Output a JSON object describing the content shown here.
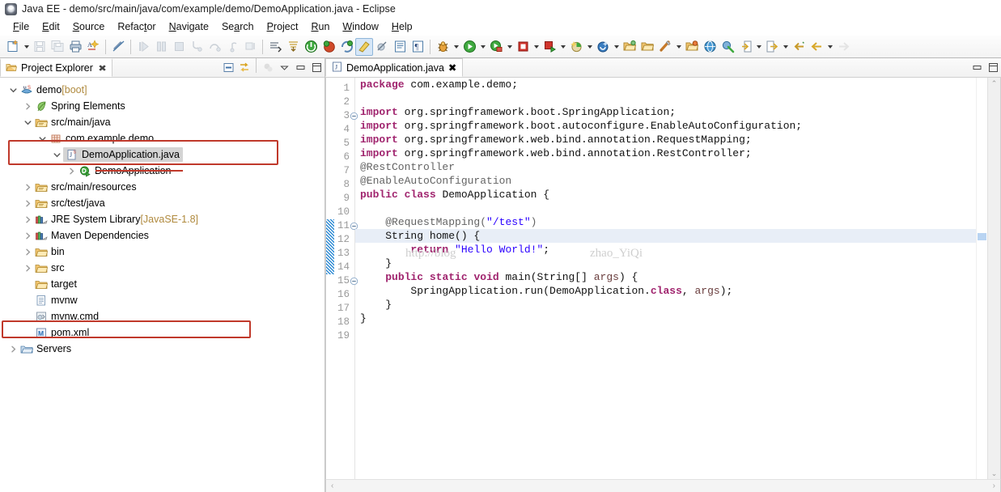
{
  "window": {
    "title": "Java EE - demo/src/main/java/com/example/demo/DemoApplication.java - Eclipse",
    "app_icon": "eclipse-icon"
  },
  "menubar": {
    "items": [
      {
        "label": "File",
        "mnemonic": "F"
      },
      {
        "label": "Edit",
        "mnemonic": "E"
      },
      {
        "label": "Source",
        "mnemonic": "S"
      },
      {
        "label": "Refactor",
        "mnemonic": "t"
      },
      {
        "label": "Navigate",
        "mnemonic": "N"
      },
      {
        "label": "Search",
        "mnemonic": "a"
      },
      {
        "label": "Project",
        "mnemonic": "P"
      },
      {
        "label": "Run",
        "mnemonic": "R"
      },
      {
        "label": "Window",
        "mnemonic": "W"
      },
      {
        "label": "Help",
        "mnemonic": "H"
      }
    ]
  },
  "toolbar": {
    "groups": [
      {
        "items": [
          {
            "name": "new-wizard-icon",
            "enabled": true,
            "dropdown": true
          },
          {
            "name": "save-icon",
            "enabled": false
          },
          {
            "name": "save-all-icon",
            "enabled": false
          },
          {
            "name": "print-icon",
            "enabled": true
          },
          {
            "name": "spell-check-icon",
            "enabled": true
          }
        ]
      },
      {
        "items": [
          {
            "name": "link-break-icon",
            "enabled": true
          }
        ]
      },
      {
        "items": [
          {
            "name": "resume-icon",
            "enabled": false
          },
          {
            "name": "suspend-icon",
            "enabled": false
          },
          {
            "name": "terminate-icon",
            "enabled": false
          },
          {
            "name": "step-into-icon",
            "enabled": false
          },
          {
            "name": "step-over-icon",
            "enabled": false
          },
          {
            "name": "step-return-icon",
            "enabled": false
          },
          {
            "name": "drop-to-frame-icon",
            "enabled": false
          }
        ]
      },
      {
        "items": [
          {
            "name": "next-annotation-icon",
            "enabled": true
          },
          {
            "name": "previous-annotation-icon",
            "enabled": true
          },
          {
            "name": "server-start-icon",
            "enabled": true
          },
          {
            "name": "server-debug-icon",
            "enabled": true
          },
          {
            "name": "server-restart-icon",
            "enabled": true
          },
          {
            "name": "toggle-markoccurrences-icon",
            "enabled": true,
            "active": true
          },
          {
            "name": "skip-breakpoints-icon",
            "enabled": true
          },
          {
            "name": "open-task-icon",
            "enabled": true
          },
          {
            "name": "show-whitespace-icon",
            "enabled": true
          }
        ]
      },
      {
        "items": [
          {
            "name": "debug-icon",
            "enabled": true,
            "dropdown": true
          },
          {
            "name": "run-icon",
            "enabled": true,
            "dropdown": true
          },
          {
            "name": "run-as-server-icon",
            "enabled": true,
            "dropdown": true
          },
          {
            "name": "stop-icon",
            "enabled": true,
            "dropdown": true
          },
          {
            "name": "run-last-icon",
            "enabled": true,
            "dropdown": true
          },
          {
            "name": "coverage-icon",
            "enabled": true,
            "dropdown": true
          },
          {
            "name": "spring-boot-icon",
            "enabled": true,
            "dropdown": true
          },
          {
            "name": "new-java-package-icon",
            "enabled": true
          },
          {
            "name": "new-folder-icon",
            "enabled": true
          },
          {
            "name": "new-class-icon",
            "enabled": true,
            "dropdown": true
          },
          {
            "name": "open-type-icon",
            "enabled": true
          },
          {
            "name": "open-web-browser-icon",
            "enabled": true
          },
          {
            "name": "external-tools-icon",
            "enabled": true
          },
          {
            "name": "import-icon",
            "enabled": true,
            "dropdown": true
          },
          {
            "name": "export-icon",
            "enabled": true,
            "dropdown": true
          },
          {
            "name": "back-history-icon",
            "enabled": true
          },
          {
            "name": "previous-edit-icon",
            "enabled": true,
            "dropdown": true
          },
          {
            "name": "forward-history-icon",
            "enabled": false
          }
        ]
      }
    ]
  },
  "explorer": {
    "tab_label": "Project Explorer",
    "tab_icon": "project-explorer-icon",
    "close_glyph": "✖",
    "tools": [
      {
        "name": "collapse-all-icon",
        "enabled": true
      },
      {
        "name": "link-with-editor-icon",
        "enabled": true
      },
      {
        "name": "focus-on-active-task-icon",
        "enabled": false
      },
      {
        "name": "view-menu-icon",
        "enabled": true
      },
      {
        "name": "minimize-view-icon",
        "enabled": true
      },
      {
        "name": "maximize-view-icon",
        "enabled": true
      }
    ],
    "tree": [
      {
        "label": "demo",
        "suffix": " [boot]",
        "icon": "spring-project-icon",
        "indent": 0,
        "twisty": "down"
      },
      {
        "label": "Spring Elements",
        "suffix": "",
        "icon": "spring-leaf-icon",
        "indent": 1,
        "twisty": "right"
      },
      {
        "label": "src/main/java",
        "suffix": "",
        "icon": "source-folder-icon",
        "indent": 1,
        "twisty": "down"
      },
      {
        "label": "com.example.demo",
        "suffix": "",
        "icon": "package-icon",
        "indent": 2,
        "twisty": "down"
      },
      {
        "label": "DemoApplication.java",
        "suffix": "",
        "icon": "java-file-icon",
        "indent": 3,
        "twisty": "down",
        "selected": true
      },
      {
        "label": "DemoApplication",
        "suffix": "",
        "icon": "java-class-run-icon",
        "indent": 4,
        "twisty": "right"
      },
      {
        "label": "src/main/resources",
        "suffix": "",
        "icon": "source-folder-icon",
        "indent": 1,
        "twisty": "right"
      },
      {
        "label": "src/test/java",
        "suffix": "",
        "icon": "source-folder-icon",
        "indent": 1,
        "twisty": "right"
      },
      {
        "label": "JRE System Library",
        "suffix": " [JavaSE-1.8]",
        "icon": "library-icon",
        "indent": 1,
        "twisty": "right"
      },
      {
        "label": "Maven Dependencies",
        "suffix": "",
        "icon": "library-icon",
        "indent": 1,
        "twisty": "right"
      },
      {
        "label": "bin",
        "suffix": "",
        "icon": "folder-icon",
        "indent": 1,
        "twisty": "right"
      },
      {
        "label": "src",
        "suffix": "",
        "icon": "folder-icon",
        "indent": 1,
        "twisty": "right"
      },
      {
        "label": "target",
        "suffix": "",
        "icon": "folder-icon",
        "indent": 1,
        "twisty": "none"
      },
      {
        "label": "mvnw",
        "suffix": "",
        "icon": "text-file-icon",
        "indent": 1,
        "twisty": "none"
      },
      {
        "label": "mvnw.cmd",
        "suffix": "",
        "icon": "cmd-file-icon",
        "indent": 1,
        "twisty": "none"
      },
      {
        "label": "pom.xml",
        "suffix": "",
        "icon": "maven-pom-icon",
        "indent": 1,
        "twisty": "none"
      },
      {
        "label": "Servers",
        "suffix": "",
        "icon": "servers-icon",
        "indent": 0,
        "twisty": "right"
      }
    ],
    "annotations": {
      "color": "#c0392b",
      "box_demoapplication_java": "highlight around com.example.demo / DemoApplication.java / DemoApplication",
      "box_pom_xml": "highlight around pom.xml",
      "strike_demoapplication": "strikethrough over DemoApplication"
    }
  },
  "editor": {
    "tab_label": "DemoApplication.java",
    "tab_icon": "java-file-icon",
    "close_glyph": "✖",
    "minimize_icon": "minimize-editor-icon",
    "maximize_icon": "maximize-editor-icon",
    "current_line": 12,
    "changed_lines": [
      11,
      12,
      13,
      14
    ],
    "folding_lines": [
      3,
      11,
      15
    ],
    "watermark_left": "http://blog",
    "watermark_right": "zhao_YiQi",
    "lines": [
      {
        "n": 1,
        "tokens": [
          {
            "t": "kw",
            "v": "package"
          },
          {
            "t": "plain",
            "v": " com.example.demo;"
          }
        ]
      },
      {
        "n": 2,
        "tokens": []
      },
      {
        "n": 3,
        "tokens": [
          {
            "t": "kw",
            "v": "import"
          },
          {
            "t": "plain",
            "v": " org.springframework.boot.SpringApplication;"
          }
        ]
      },
      {
        "n": 4,
        "tokens": [
          {
            "t": "kw",
            "v": "import"
          },
          {
            "t": "plain",
            "v": " org.springframework.boot.autoconfigure.EnableAutoConfiguration;"
          }
        ]
      },
      {
        "n": 5,
        "tokens": [
          {
            "t": "kw",
            "v": "import"
          },
          {
            "t": "plain",
            "v": " org.springframework.web.bind.annotation.RequestMapping;"
          }
        ]
      },
      {
        "n": 6,
        "tokens": [
          {
            "t": "kw",
            "v": "import"
          },
          {
            "t": "plain",
            "v": " org.springframework.web.bind.annotation.RestController;"
          }
        ]
      },
      {
        "n": 7,
        "tokens": [
          {
            "t": "annon",
            "v": "@RestController"
          }
        ]
      },
      {
        "n": 8,
        "tokens": [
          {
            "t": "annon",
            "v": "@EnableAutoConfiguration"
          }
        ]
      },
      {
        "n": 9,
        "tokens": [
          {
            "t": "kw",
            "v": "public"
          },
          {
            "t": "plain",
            "v": " "
          },
          {
            "t": "kw",
            "v": "class"
          },
          {
            "t": "plain",
            "v": " DemoApplication {"
          }
        ]
      },
      {
        "n": 10,
        "tokens": []
      },
      {
        "n": 11,
        "tokens": [
          {
            "t": "plain",
            "v": "    "
          },
          {
            "t": "annon",
            "v": "@RequestMapping("
          },
          {
            "t": "str",
            "v": "\"/test\""
          },
          {
            "t": "annon",
            "v": ")"
          }
        ]
      },
      {
        "n": 12,
        "tokens": [
          {
            "t": "plain",
            "v": "    String home() {"
          }
        ]
      },
      {
        "n": 13,
        "tokens": [
          {
            "t": "plain",
            "v": "        "
          },
          {
            "t": "kw",
            "v": "return"
          },
          {
            "t": "plain",
            "v": " "
          },
          {
            "t": "str",
            "v": "\"Hello World!\""
          },
          {
            "t": "plain",
            "v": ";"
          }
        ]
      },
      {
        "n": 14,
        "tokens": [
          {
            "t": "plain",
            "v": "    }"
          }
        ]
      },
      {
        "n": 15,
        "tokens": [
          {
            "t": "plain",
            "v": "    "
          },
          {
            "t": "kw",
            "v": "public"
          },
          {
            "t": "plain",
            "v": " "
          },
          {
            "t": "kw",
            "v": "static"
          },
          {
            "t": "plain",
            "v": " "
          },
          {
            "t": "kw",
            "v": "void"
          },
          {
            "t": "plain",
            "v": " main(String[] "
          },
          {
            "t": "param",
            "v": "args"
          },
          {
            "t": "plain",
            "v": ") {"
          }
        ]
      },
      {
        "n": 16,
        "tokens": [
          {
            "t": "plain",
            "v": "        SpringApplication.run(DemoApplication."
          },
          {
            "t": "kw",
            "v": "class"
          },
          {
            "t": "plain",
            "v": ", "
          },
          {
            "t": "param",
            "v": "args"
          },
          {
            "t": "plain",
            "v": ");"
          }
        ]
      },
      {
        "n": 17,
        "tokens": [
          {
            "t": "plain",
            "v": "    }"
          }
        ]
      },
      {
        "n": 18,
        "tokens": [
          {
            "t": "plain",
            "v": "}"
          }
        ]
      },
      {
        "n": 19,
        "tokens": []
      }
    ],
    "scroll_up_glyph": "⌃",
    "scroll_down_glyph": "⌄",
    "hscroll_left_glyph": "‹",
    "hscroll_right_glyph": "›"
  },
  "colors": {
    "keyword": "#a0246e",
    "string": "#2a00ff",
    "annotation": "#646464",
    "line_number": "#9a9a9a",
    "current_line_bg": "#e8eef7",
    "changebar": "#2e8bd4",
    "annotation_red": "#c0392b",
    "selection_bg": "#d4d4d4"
  }
}
